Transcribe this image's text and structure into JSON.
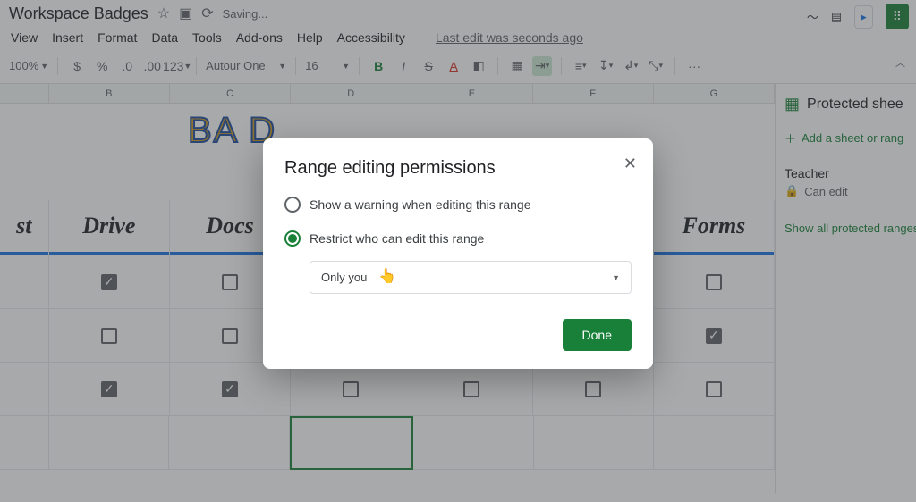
{
  "doc": {
    "title": "Workspace Badges",
    "saving": "Saving...",
    "last_edit": "Last edit was seconds ago"
  },
  "menus": {
    "view": "View",
    "insert": "Insert",
    "format": "Format",
    "data": "Data",
    "tools": "Tools",
    "addons": "Add-ons",
    "help": "Help",
    "accessibility": "Accessibility"
  },
  "toolbar": {
    "zoom": "100%",
    "currency": "$",
    "percent": "%",
    "dec_dec": ".0",
    "inc_dec": ".00",
    "numfmt": "123",
    "font_name": "Autour One",
    "font_size": "16",
    "bold": "B",
    "italic": "I",
    "strike": "S",
    "underline_a": "A",
    "more": "···"
  },
  "columns": {
    "b": "B",
    "c": "C",
    "d": "D",
    "e": "E",
    "f": "F",
    "g": "G"
  },
  "col_titles": {
    "a": "st",
    "b": "Drive",
    "c": "Docs",
    "g": "Forms"
  },
  "grid": {
    "rows": [
      {
        "a": false,
        "b": true,
        "c": false,
        "d": false,
        "e": false,
        "f": false,
        "g": false
      },
      {
        "a": false,
        "b": false,
        "c": false,
        "d": false,
        "e": false,
        "f": false,
        "g": true
      },
      {
        "a": false,
        "b": true,
        "c": true,
        "d": false,
        "e": false,
        "f": false,
        "g": false
      },
      {
        "a": false,
        "b": false,
        "c": false,
        "d": false,
        "e": false,
        "f": false,
        "g": false
      }
    ]
  },
  "panel": {
    "title": "Protected shee",
    "add": "Add a sheet or rang",
    "role_name": "Teacher",
    "role_perm": "Can edit",
    "show_all": "Show all protected ranges"
  },
  "dialog": {
    "title": "Range editing permissions",
    "option_warning": "Show a warning when editing this range",
    "option_restrict": "Restrict who can edit this range",
    "dropdown_value": "Only you",
    "done": "Done"
  },
  "badge_text": "BA               D"
}
